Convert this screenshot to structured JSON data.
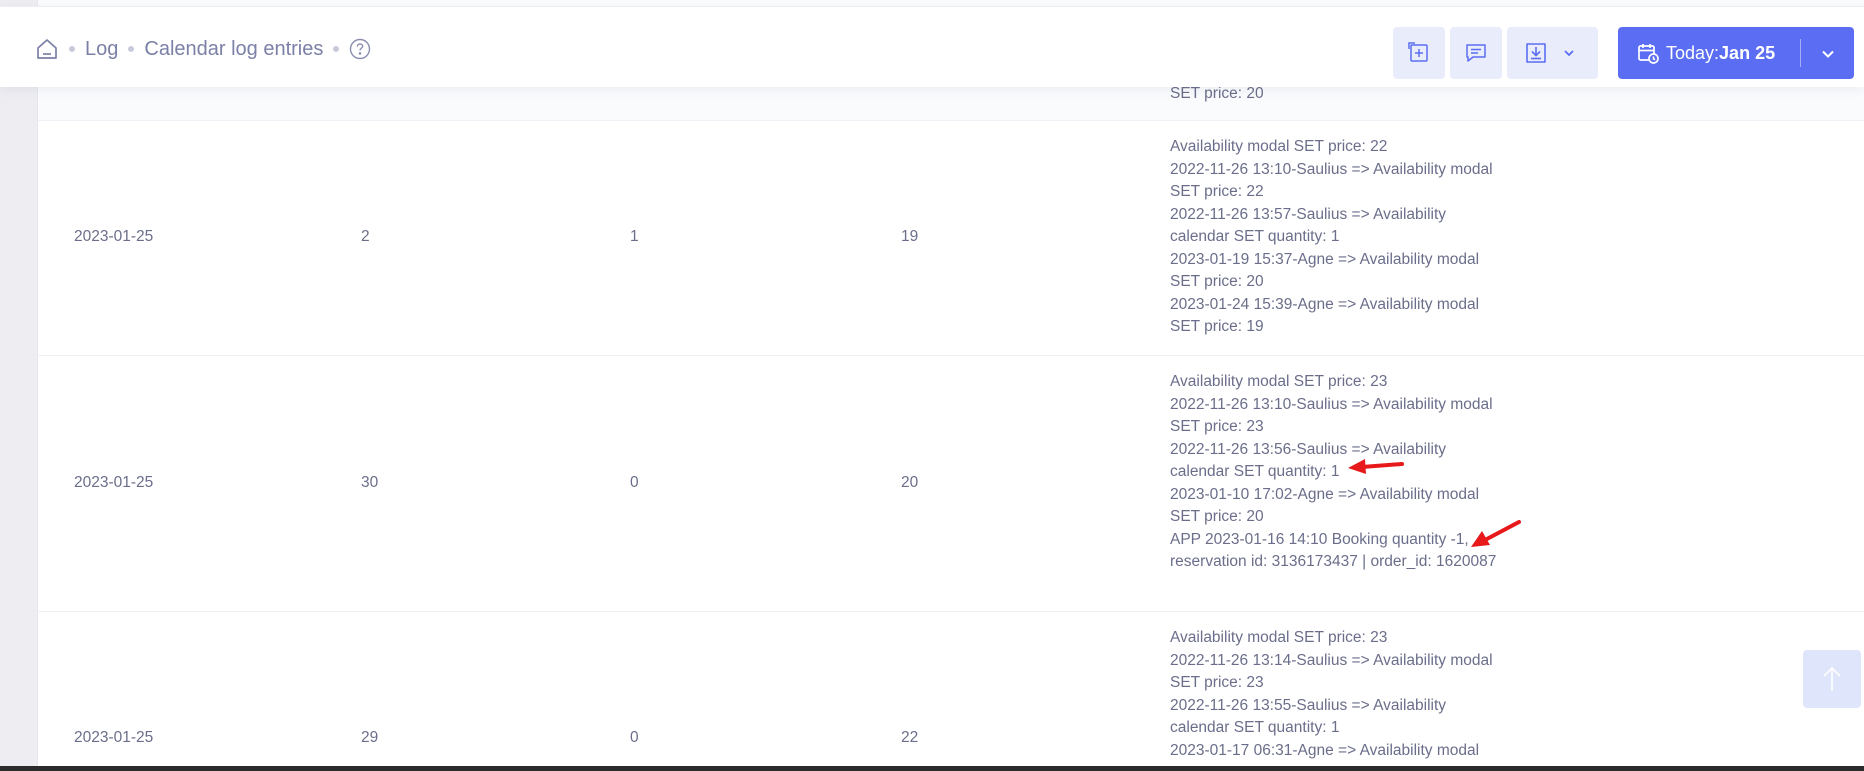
{
  "breadcrumb": {
    "items": [
      "Log",
      "Calendar log entries"
    ]
  },
  "toolbar": {
    "today_label": "Today:",
    "today_date": "Jan 25"
  },
  "colors": {
    "accent": "#5b6ef3",
    "muted_button": "#e9ecfa",
    "annotation_arrow": "#e8191b"
  },
  "rows": [
    {
      "log": [
        "SET price: 20"
      ]
    },
    {
      "date": "2023-01-25",
      "col2": "2",
      "col3": "1",
      "col4": "19",
      "log": [
        "Availability modal SET price: 22",
        "2022-11-26 13:10-Saulius => Availability modal",
        "SET price: 22",
        "2022-11-26 13:57-Saulius => Availability",
        "calendar SET quantity: 1",
        "2023-01-19 15:37-Agne => Availability modal",
        "SET price: 20",
        "2023-01-24 15:39-Agne => Availability modal",
        "SET price: 19"
      ]
    },
    {
      "date": "2023-01-25",
      "col2": "30",
      "col3": "0",
      "col4": "20",
      "log": [
        "Availability modal SET price: 23",
        "2022-11-26 13:10-Saulius => Availability modal",
        "SET price: 23",
        "2022-11-26 13:56-Saulius => Availability",
        "calendar SET quantity: 1",
        "2023-01-10 17:02-Agne => Availability modal",
        "SET price: 20",
        "APP 2023-01-16 14:10 Booking quantity -1,",
        "reservation id: 3136173437 | order_id: 1620087"
      ]
    },
    {
      "date": "2023-01-25",
      "col2": "29",
      "col3": "0",
      "col4": "22",
      "log": [
        "Availability modal SET price: 23",
        "2022-11-26 13:14-Saulius => Availability modal",
        "SET price: 23",
        "2022-11-26 13:55-Saulius => Availability",
        "calendar SET quantity: 1",
        "2023-01-17 06:31-Agne => Availability modal"
      ]
    }
  ]
}
